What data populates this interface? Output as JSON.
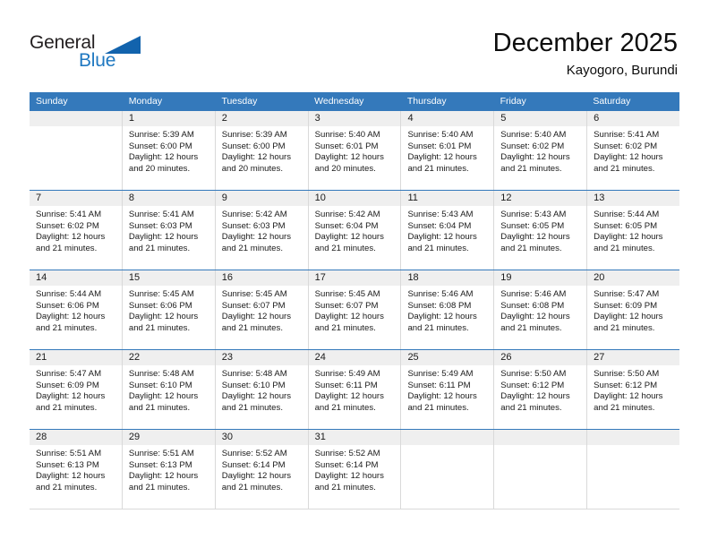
{
  "brand": {
    "name_part1": "General",
    "name_part2": "Blue",
    "logo_icon": "blue-triangle-icon",
    "accent_color": "#1263ad"
  },
  "header": {
    "title": "December 2025",
    "subtitle": "Kayogoro, Burundi"
  },
  "calendar": {
    "header_color": "#3479bb",
    "weekdays": [
      "Sunday",
      "Monday",
      "Tuesday",
      "Wednesday",
      "Thursday",
      "Friday",
      "Saturday"
    ],
    "weeks": [
      [
        {
          "day": "",
          "empty": true,
          "sunrise": "",
          "sunset": "",
          "daylight1": "",
          "daylight2": ""
        },
        {
          "day": "1",
          "sunrise": "Sunrise: 5:39 AM",
          "sunset": "Sunset: 6:00 PM",
          "daylight1": "Daylight: 12 hours",
          "daylight2": "and 20 minutes."
        },
        {
          "day": "2",
          "sunrise": "Sunrise: 5:39 AM",
          "sunset": "Sunset: 6:00 PM",
          "daylight1": "Daylight: 12 hours",
          "daylight2": "and 20 minutes."
        },
        {
          "day": "3",
          "sunrise": "Sunrise: 5:40 AM",
          "sunset": "Sunset: 6:01 PM",
          "daylight1": "Daylight: 12 hours",
          "daylight2": "and 20 minutes."
        },
        {
          "day": "4",
          "sunrise": "Sunrise: 5:40 AM",
          "sunset": "Sunset: 6:01 PM",
          "daylight1": "Daylight: 12 hours",
          "daylight2": "and 21 minutes."
        },
        {
          "day": "5",
          "sunrise": "Sunrise: 5:40 AM",
          "sunset": "Sunset: 6:02 PM",
          "daylight1": "Daylight: 12 hours",
          "daylight2": "and 21 minutes."
        },
        {
          "day": "6",
          "sunrise": "Sunrise: 5:41 AM",
          "sunset": "Sunset: 6:02 PM",
          "daylight1": "Daylight: 12 hours",
          "daylight2": "and 21 minutes."
        }
      ],
      [
        {
          "day": "7",
          "sunrise": "Sunrise: 5:41 AM",
          "sunset": "Sunset: 6:02 PM",
          "daylight1": "Daylight: 12 hours",
          "daylight2": "and 21 minutes."
        },
        {
          "day": "8",
          "sunrise": "Sunrise: 5:41 AM",
          "sunset": "Sunset: 6:03 PM",
          "daylight1": "Daylight: 12 hours",
          "daylight2": "and 21 minutes."
        },
        {
          "day": "9",
          "sunrise": "Sunrise: 5:42 AM",
          "sunset": "Sunset: 6:03 PM",
          "daylight1": "Daylight: 12 hours",
          "daylight2": "and 21 minutes."
        },
        {
          "day": "10",
          "sunrise": "Sunrise: 5:42 AM",
          "sunset": "Sunset: 6:04 PM",
          "daylight1": "Daylight: 12 hours",
          "daylight2": "and 21 minutes."
        },
        {
          "day": "11",
          "sunrise": "Sunrise: 5:43 AM",
          "sunset": "Sunset: 6:04 PM",
          "daylight1": "Daylight: 12 hours",
          "daylight2": "and 21 minutes."
        },
        {
          "day": "12",
          "sunrise": "Sunrise: 5:43 AM",
          "sunset": "Sunset: 6:05 PM",
          "daylight1": "Daylight: 12 hours",
          "daylight2": "and 21 minutes."
        },
        {
          "day": "13",
          "sunrise": "Sunrise: 5:44 AM",
          "sunset": "Sunset: 6:05 PM",
          "daylight1": "Daylight: 12 hours",
          "daylight2": "and 21 minutes."
        }
      ],
      [
        {
          "day": "14",
          "sunrise": "Sunrise: 5:44 AM",
          "sunset": "Sunset: 6:06 PM",
          "daylight1": "Daylight: 12 hours",
          "daylight2": "and 21 minutes."
        },
        {
          "day": "15",
          "sunrise": "Sunrise: 5:45 AM",
          "sunset": "Sunset: 6:06 PM",
          "daylight1": "Daylight: 12 hours",
          "daylight2": "and 21 minutes."
        },
        {
          "day": "16",
          "sunrise": "Sunrise: 5:45 AM",
          "sunset": "Sunset: 6:07 PM",
          "daylight1": "Daylight: 12 hours",
          "daylight2": "and 21 minutes."
        },
        {
          "day": "17",
          "sunrise": "Sunrise: 5:45 AM",
          "sunset": "Sunset: 6:07 PM",
          "daylight1": "Daylight: 12 hours",
          "daylight2": "and 21 minutes."
        },
        {
          "day": "18",
          "sunrise": "Sunrise: 5:46 AM",
          "sunset": "Sunset: 6:08 PM",
          "daylight1": "Daylight: 12 hours",
          "daylight2": "and 21 minutes."
        },
        {
          "day": "19",
          "sunrise": "Sunrise: 5:46 AM",
          "sunset": "Sunset: 6:08 PM",
          "daylight1": "Daylight: 12 hours",
          "daylight2": "and 21 minutes."
        },
        {
          "day": "20",
          "sunrise": "Sunrise: 5:47 AM",
          "sunset": "Sunset: 6:09 PM",
          "daylight1": "Daylight: 12 hours",
          "daylight2": "and 21 minutes."
        }
      ],
      [
        {
          "day": "21",
          "sunrise": "Sunrise: 5:47 AM",
          "sunset": "Sunset: 6:09 PM",
          "daylight1": "Daylight: 12 hours",
          "daylight2": "and 21 minutes."
        },
        {
          "day": "22",
          "sunrise": "Sunrise: 5:48 AM",
          "sunset": "Sunset: 6:10 PM",
          "daylight1": "Daylight: 12 hours",
          "daylight2": "and 21 minutes."
        },
        {
          "day": "23",
          "sunrise": "Sunrise: 5:48 AM",
          "sunset": "Sunset: 6:10 PM",
          "daylight1": "Daylight: 12 hours",
          "daylight2": "and 21 minutes."
        },
        {
          "day": "24",
          "sunrise": "Sunrise: 5:49 AM",
          "sunset": "Sunset: 6:11 PM",
          "daylight1": "Daylight: 12 hours",
          "daylight2": "and 21 minutes."
        },
        {
          "day": "25",
          "sunrise": "Sunrise: 5:49 AM",
          "sunset": "Sunset: 6:11 PM",
          "daylight1": "Daylight: 12 hours",
          "daylight2": "and 21 minutes."
        },
        {
          "day": "26",
          "sunrise": "Sunrise: 5:50 AM",
          "sunset": "Sunset: 6:12 PM",
          "daylight1": "Daylight: 12 hours",
          "daylight2": "and 21 minutes."
        },
        {
          "day": "27",
          "sunrise": "Sunrise: 5:50 AM",
          "sunset": "Sunset: 6:12 PM",
          "daylight1": "Daylight: 12 hours",
          "daylight2": "and 21 minutes."
        }
      ],
      [
        {
          "day": "28",
          "sunrise": "Sunrise: 5:51 AM",
          "sunset": "Sunset: 6:13 PM",
          "daylight1": "Daylight: 12 hours",
          "daylight2": "and 21 minutes."
        },
        {
          "day": "29",
          "sunrise": "Sunrise: 5:51 AM",
          "sunset": "Sunset: 6:13 PM",
          "daylight1": "Daylight: 12 hours",
          "daylight2": "and 21 minutes."
        },
        {
          "day": "30",
          "sunrise": "Sunrise: 5:52 AM",
          "sunset": "Sunset: 6:14 PM",
          "daylight1": "Daylight: 12 hours",
          "daylight2": "and 21 minutes."
        },
        {
          "day": "31",
          "sunrise": "Sunrise: 5:52 AM",
          "sunset": "Sunset: 6:14 PM",
          "daylight1": "Daylight: 12 hours",
          "daylight2": "and 21 minutes."
        },
        {
          "day": "",
          "empty": true,
          "sunrise": "",
          "sunset": "",
          "daylight1": "",
          "daylight2": ""
        },
        {
          "day": "",
          "empty": true,
          "sunrise": "",
          "sunset": "",
          "daylight1": "",
          "daylight2": ""
        },
        {
          "day": "",
          "empty": true,
          "sunrise": "",
          "sunset": "",
          "daylight1": "",
          "daylight2": ""
        }
      ]
    ]
  }
}
